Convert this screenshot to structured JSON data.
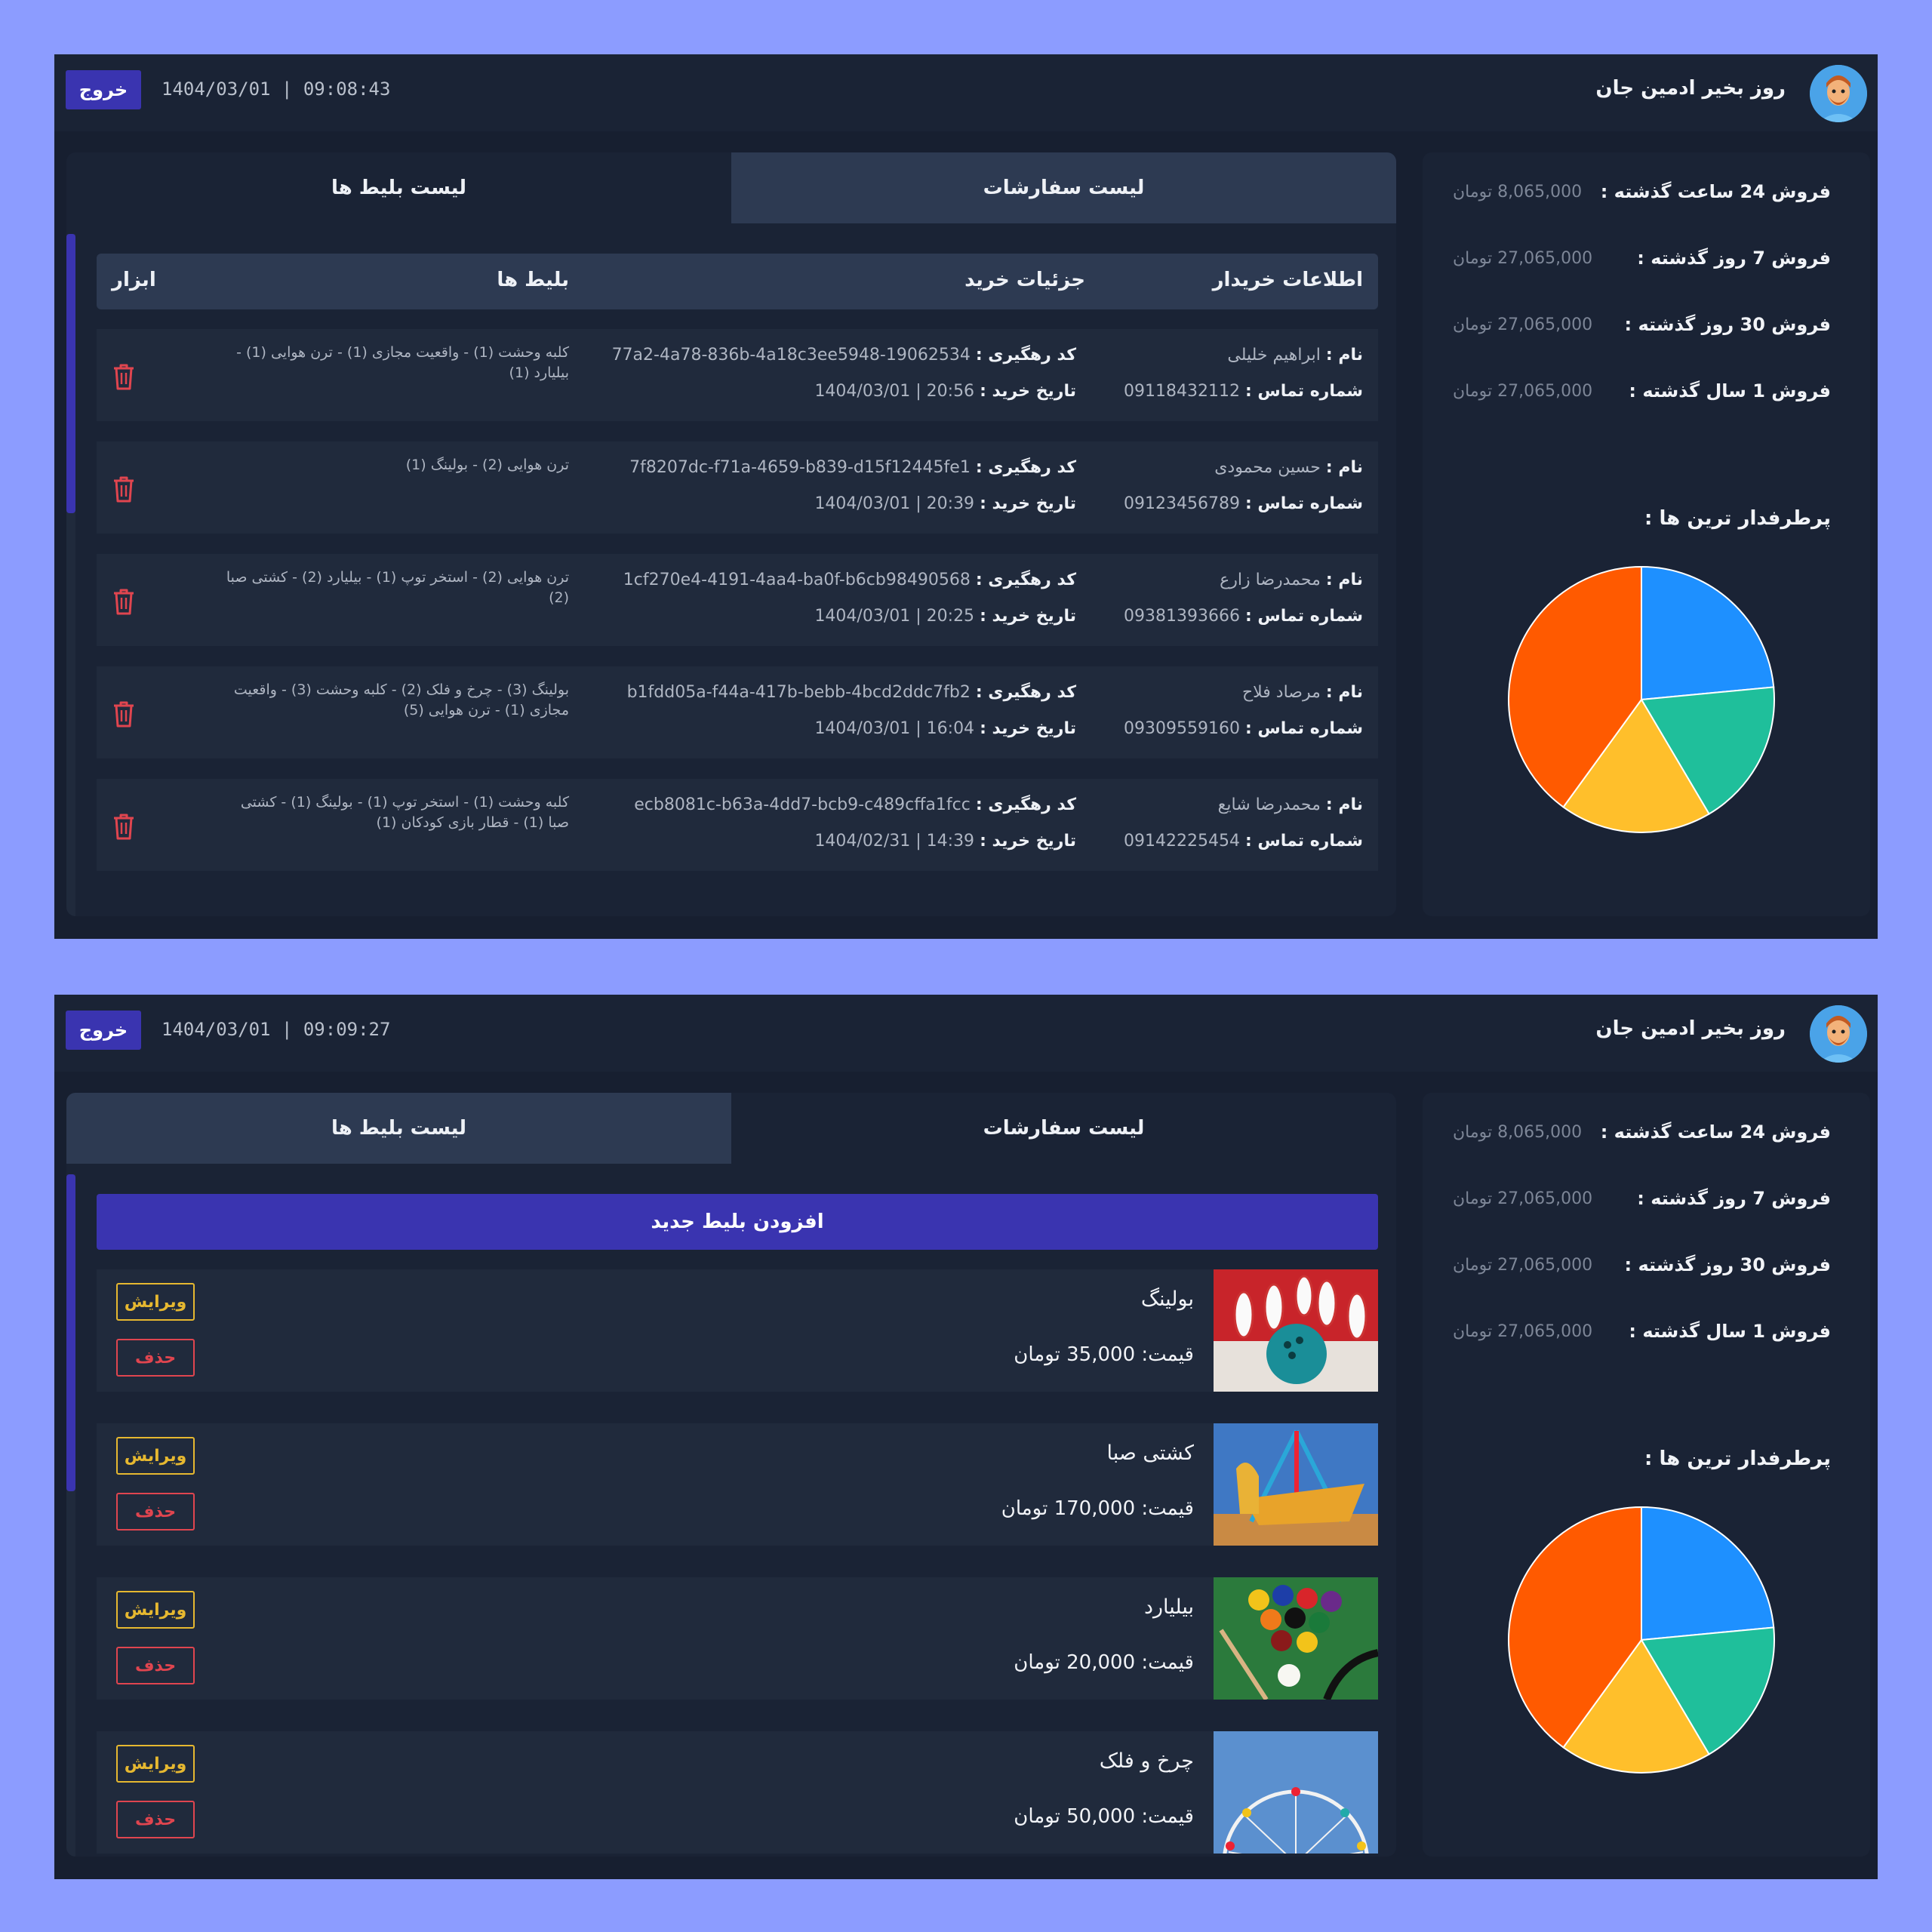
{
  "header": {
    "greeting": "روز بخیر ادمین جان",
    "logout_label": "خروج",
    "clock_a": "1404/03/01 | 09:08:43",
    "clock_b": "1404/03/01 | 09:09:27"
  },
  "stats": {
    "items": [
      {
        "label": "فروش 24 ساعت گذشته :",
        "value": "8,065,000 تومان"
      },
      {
        "label": "فروش 7 روز گذشته :",
        "value": "27,065,000 تومان"
      },
      {
        "label": "فروش 30 روز گذشته :",
        "value": "27,065,000 تومان"
      },
      {
        "label": "فروش 1 سال گذشته :",
        "value": "27,065,000 تومان"
      }
    ],
    "popular_title": "پرطرفدار ترین ها :"
  },
  "chart_data": {
    "type": "pie",
    "title": "پرطرفدار ترین ها :",
    "slices": [
      {
        "value": 23.5,
        "color": "#1e90ff"
      },
      {
        "value": 18.0,
        "color": "#1fbf9b"
      },
      {
        "value": 18.5,
        "color": "#ffbf2b"
      },
      {
        "value": 40.0,
        "color": "#ff5a00"
      }
    ]
  },
  "tabs": {
    "orders": "لیست سفارشات",
    "tickets": "لیست بلیط ها"
  },
  "orders_table": {
    "headers": {
      "buyer": "اطلاعات خریدار",
      "details": "جزئیات خرید",
      "tickets": "بلیط ها",
      "tools": "ابزار"
    },
    "name_label": "نام :",
    "phone_label": "شماره تماس :",
    "code_label": "کد رهگیری :",
    "date_label": "تاریخ خرید :",
    "rows": [
      {
        "name": "ابراهیم خلیلی",
        "phone": "09118432112",
        "code": "77a2-4a78-836b-4a18c3ee5948-19062534",
        "date": "20:56 | 1404/03/01",
        "tickets": "کلبه وحشت (1) - واقعیت مجازی (1) - ترن هوایی (1) - بیلیارد (1)"
      },
      {
        "name": "حسین محمودی",
        "phone": "09123456789",
        "code": "7f8207dc-f71a-4659-b839-d15f12445fe1",
        "date": "20:39 | 1404/03/01",
        "tickets": "ترن هوایی (2) - بولینگ (1)"
      },
      {
        "name": "محمدرضا زارع",
        "phone": "09381393666",
        "code": "1cf270e4-4191-4aa4-ba0f-b6cb98490568",
        "date": "20:25 | 1404/03/01",
        "tickets": "ترن هوایی (2) - استخر توپ (1) - بیلیارد (2) - کشتی صبا (2)"
      },
      {
        "name": "مرصاد فلاح",
        "phone": "09309559160",
        "code": "b1fdd05a-f44a-417b-bebb-4bcd2ddc7fb2",
        "date": "16:04 | 1404/03/01",
        "tickets": "بولینگ (3) - چرخ و فلک (2) - کلبه وحشت (3) - واقعیت مجازی (1) - ترن هوایی (5)"
      },
      {
        "name": "محمدرضا شایع",
        "phone": "09142225454",
        "code": "ecb8081c-b63a-4dd7-bcb9-c489cffa1fcc",
        "date": "14:39 | 1404/02/31",
        "tickets": "کلبه وحشت (1) - استخر توپ (1) - بولینگ (1) - کشتی صبا (1) - قطار بازی کودکان (1)"
      }
    ]
  },
  "tickets_list": {
    "add_label": "افزودن بلیط جدید",
    "edit_label": "ویرایش",
    "delete_label": "حذف",
    "items": [
      {
        "name": "بولینگ",
        "price": "قیمت: 35,000 تومان"
      },
      {
        "name": "کشتی صبا",
        "price": "قیمت: 170,000 تومان"
      },
      {
        "name": "بیلیارد",
        "price": "قیمت: 20,000 تومان"
      },
      {
        "name": "چرخ و فلک",
        "price": "قیمت: 50,000 تومان"
      }
    ]
  },
  "colors": {
    "accent": "#3a34b0",
    "panel": "#171f30",
    "card": "#1a2335",
    "edit": "#e6b830",
    "delete": "#e0454f"
  }
}
